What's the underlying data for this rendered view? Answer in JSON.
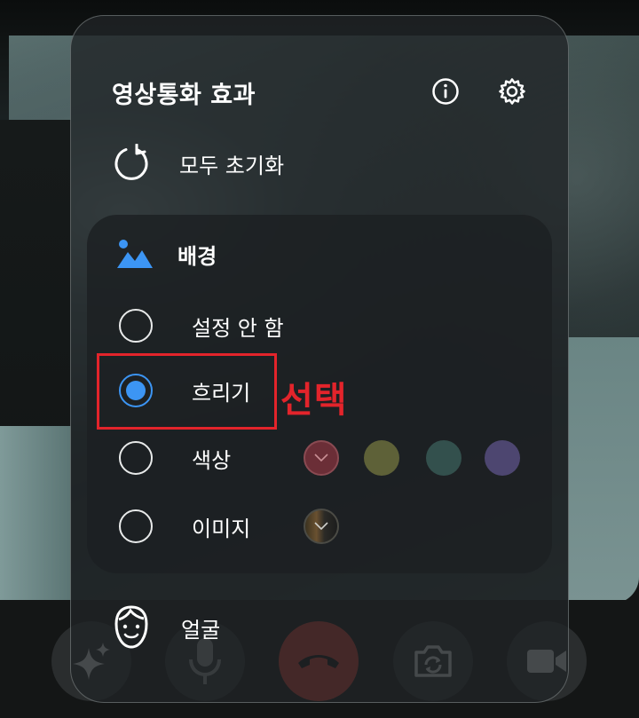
{
  "panel": {
    "title": "영상통화 효과",
    "info_icon": "info-icon",
    "settings_icon": "gear-icon",
    "reset_label": "모두 초기화",
    "reset_icon": "reset-icon",
    "background": {
      "title": "배경",
      "icon": "landscape-icon",
      "options": [
        {
          "label": "설정 안 함",
          "selected": false
        },
        {
          "label": "흐리기",
          "selected": true
        },
        {
          "label": "색상",
          "selected": false
        },
        {
          "label": "이미지",
          "selected": false
        }
      ],
      "colors": [
        "#6b2e37",
        "#5e6138",
        "#33504d",
        "#4d4670"
      ],
      "selected_color_index": 0,
      "accent": "#3c95f4"
    },
    "face_label": "얼굴",
    "face_icon": "face-icon"
  },
  "controls": {
    "items": [
      "effects-sparkle-icon",
      "microphone-icon",
      "end-call-icon",
      "flip-camera-icon",
      "video-camera-icon"
    ],
    "end_call_color": "#c43a2f"
  },
  "annotation": {
    "text": "선택",
    "color": "#e3242b"
  }
}
